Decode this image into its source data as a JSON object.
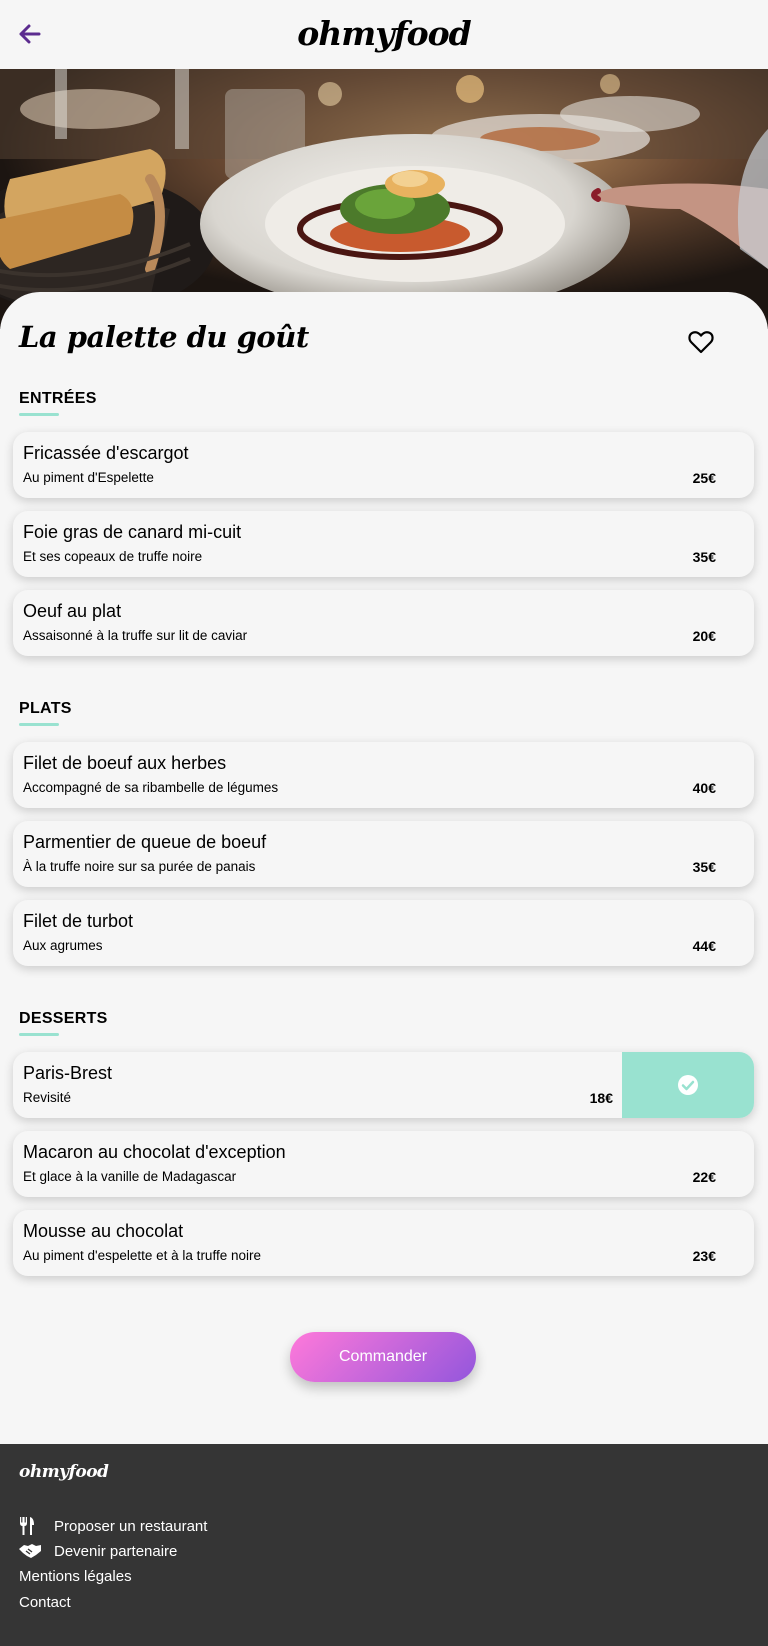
{
  "header": {
    "logo": "ohmyfood",
    "back_icon": "arrow-left-icon",
    "accent_color": "#5c2c8f"
  },
  "restaurant": {
    "name": "La palette du goût",
    "favorite_icon": "heart-outline-icon"
  },
  "sections": [
    {
      "title": "ENTRÉES",
      "dishes": [
        {
          "name": "Fricassée d'escargot",
          "description": "Au piment d'Espelette",
          "price": "25€"
        },
        {
          "name": "Foie gras de canard mi-cuit",
          "description": "Et ses copeaux de truffe noire",
          "price": "35€"
        },
        {
          "name": "Oeuf au plat",
          "description": "Assaisonné à la truffe sur lit de caviar",
          "price": "20€"
        }
      ]
    },
    {
      "title": "PLATS",
      "dishes": [
        {
          "name": "Filet de boeuf aux herbes",
          "description": "Accompagné de sa ribambelle de légumes",
          "price": "40€"
        },
        {
          "name": "Parmentier de queue de boeuf",
          "description": "À la truffe noire sur sa purée de panais",
          "price": "35€"
        },
        {
          "name": "Filet de turbot",
          "description": "Aux agrumes",
          "price": "44€"
        }
      ]
    },
    {
      "title": "DESSERTS",
      "dishes": [
        {
          "name": "Paris-Brest",
          "description": "Revisité",
          "price": "18€",
          "selected": true
        },
        {
          "name": "Macaron au chocolat d'exception",
          "description": "Et glace à la vanille de Madagascar",
          "price": "22€"
        },
        {
          "name": "Mousse au chocolat",
          "description": "Au piment d'espelette et à la truffe noire",
          "price": "23€"
        }
      ]
    }
  ],
  "selected_indicator": {
    "icon": "check-circle-icon",
    "color": "#99e2d0"
  },
  "order_button": {
    "label": "Commander",
    "gradient_start": "#ff79da",
    "gradient_end": "#9356dc"
  },
  "footer": {
    "logo": "ohmyfood",
    "links": [
      {
        "label": "Proposer un restaurant",
        "icon": "utensils-icon"
      },
      {
        "label": "Devenir partenaire",
        "icon": "handshake-icon"
      },
      {
        "label": "Mentions légales"
      },
      {
        "label": "Contact"
      }
    ]
  }
}
